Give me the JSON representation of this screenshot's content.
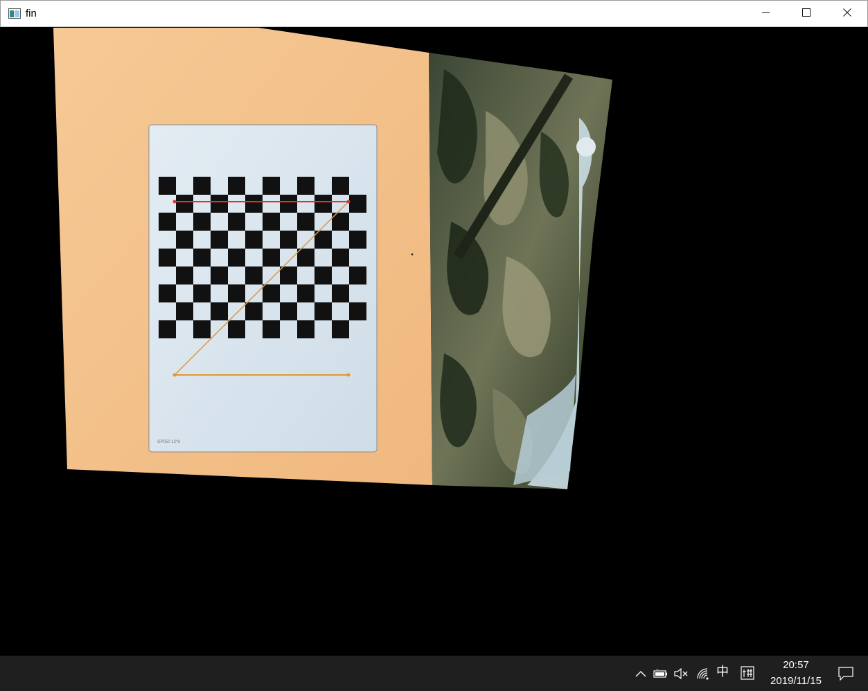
{
  "window": {
    "title": "fin",
    "icons": {
      "app": "app-window-icon",
      "minimize": "minimize-icon",
      "maximize": "maximize-icon",
      "close": "close-icon"
    }
  },
  "canvas": {
    "content": "camera-frame-warped-checkerboard",
    "colors": {
      "background": "#000000",
      "cardboard": "#f3c08a",
      "board_paper": "#dbe6ef",
      "square": "#111111",
      "line_red": "#e0322a",
      "line_orange": "#e8952d",
      "fabric_dark": "#2e3b2a",
      "fabric_light": "#8a8c68"
    }
  },
  "taskbar": {
    "tray_icons": [
      "chevron-up-icon",
      "battery-icon",
      "volume-muted-icon",
      "wifi-icon"
    ],
    "ime_language": "中",
    "ime_mode_icon": "ime-pinyin-icon",
    "clock": {
      "time": "20:57",
      "date": "2019/11/15"
    },
    "notification_icon": "action-center-icon"
  }
}
